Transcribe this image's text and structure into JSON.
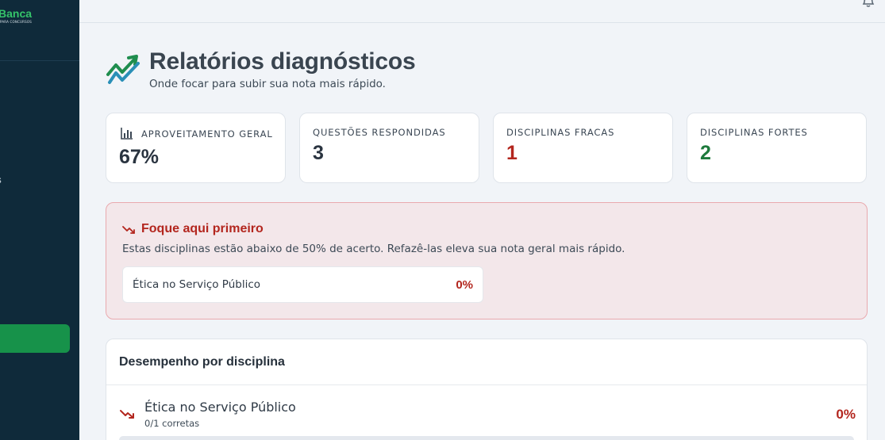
{
  "sidebar": {
    "brand_name": "Banca",
    "brand_tagline": "PARA CONCURSOS",
    "nav_item_label": "os"
  },
  "header": {
    "title": "Relatórios diagnósticos",
    "subtitle": "Onde focar para subir sua nota mais rápido."
  },
  "stats": [
    {
      "label": "Aproveitamento geral",
      "value": "67%"
    },
    {
      "label": "Questões respondidas",
      "value": "3"
    },
    {
      "label": "Disciplinas fracas",
      "value": "1"
    },
    {
      "label": "Disciplinas fortes",
      "value": "2"
    }
  ],
  "focus": {
    "title": "Foque aqui primeiro",
    "description": "Estas disciplinas estão abaixo de 50% de acerto. Refazê-las eleva sua nota geral mais rápido.",
    "items": [
      {
        "name": "Ética no Serviço Público",
        "pct": "0%"
      }
    ]
  },
  "performance": {
    "heading": "Desempenho por disciplina",
    "rows": [
      {
        "name": "Ética no Serviço Público",
        "sub": "0/1 corretas",
        "pct": "0%",
        "progress": 0
      }
    ]
  },
  "colors": {
    "sidebar_bg": "#0f2a3a",
    "accent_green": "#17924a",
    "weak_red": "#b3261e",
    "strong_green": "#1e7a3c"
  },
  "icons": {
    "header": "trend-chart-icon",
    "stat": "bar-chart-icon",
    "focus": "trending-down-icon",
    "topbar": "bell-icon"
  }
}
